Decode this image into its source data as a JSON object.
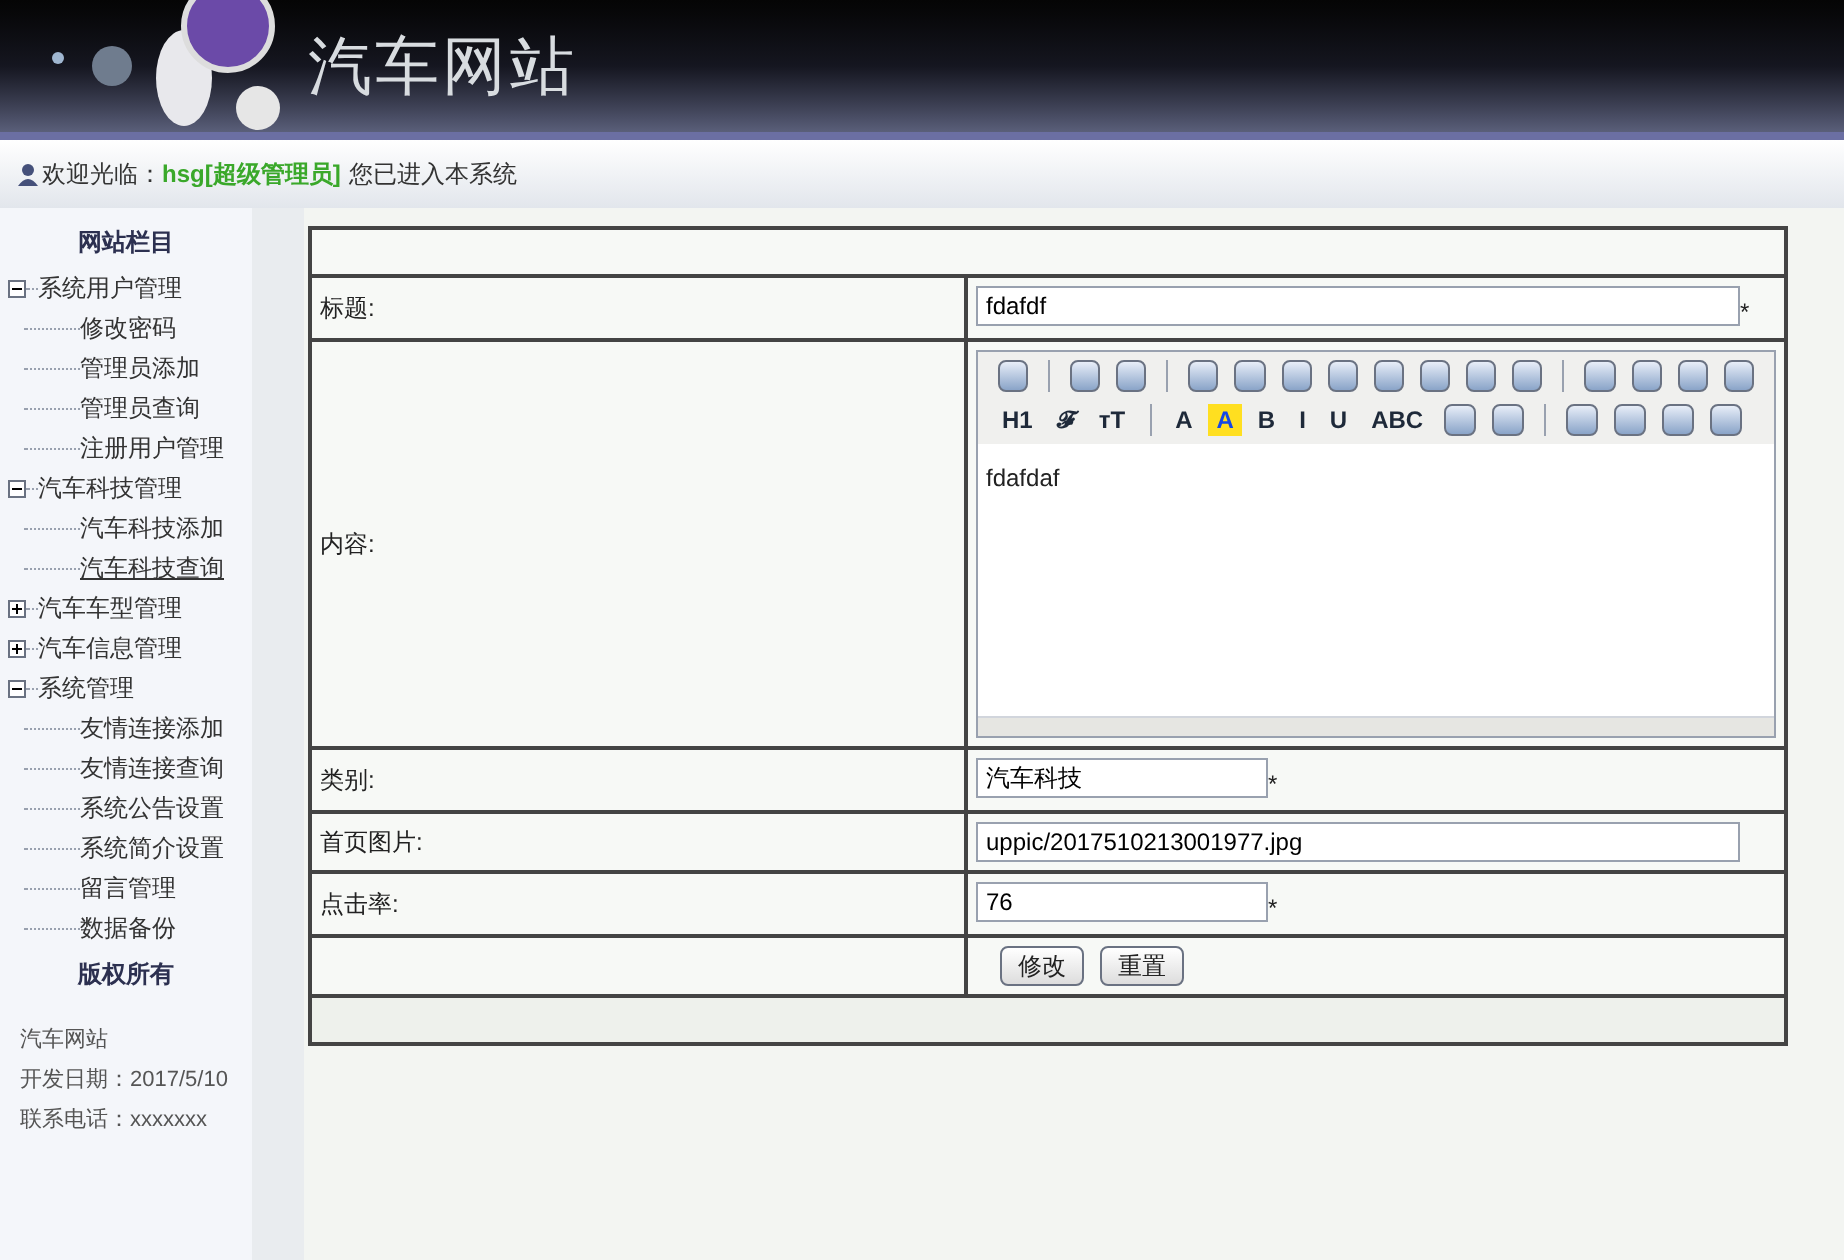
{
  "header": {
    "title": "汽车网站"
  },
  "welcome": {
    "greeting": "欢迎光临：",
    "user": "hsg[超级管理员]",
    "message": "您已进入本系统"
  },
  "sidebar": {
    "heading": "网站栏目",
    "tree": [
      {
        "label": "系统用户管理",
        "expanded": true,
        "children": [
          {
            "label": "修改密码",
            "selected": false
          },
          {
            "label": "管理员添加",
            "selected": false
          },
          {
            "label": "管理员查询",
            "selected": false
          },
          {
            "label": "注册用户管理",
            "selected": false
          }
        ]
      },
      {
        "label": "汽车科技管理",
        "expanded": true,
        "children": [
          {
            "label": "汽车科技添加",
            "selected": false
          },
          {
            "label": "汽车科技查询",
            "selected": true
          }
        ]
      },
      {
        "label": "汽车车型管理",
        "expanded": false
      },
      {
        "label": "汽车信息管理",
        "expanded": false
      },
      {
        "label": "系统管理",
        "expanded": true,
        "children": [
          {
            "label": "友情连接添加",
            "selected": false
          },
          {
            "label": "友情连接查询",
            "selected": false
          },
          {
            "label": "系统公告设置",
            "selected": false
          },
          {
            "label": "系统简介设置",
            "selected": false
          },
          {
            "label": "留言管理",
            "selected": false
          },
          {
            "label": "数据备份",
            "selected": false
          }
        ]
      }
    ],
    "copyright": "版权所有",
    "footer": [
      "汽车网站",
      "开发日期：2017/5/10",
      "联系电话：xxxxxxx"
    ]
  },
  "form": {
    "rows": [
      {
        "kind": "wide-input",
        "label": "标题:",
        "value": "fdafdf",
        "mark": "*"
      },
      {
        "kind": "editor",
        "label": "内容:",
        "value": "fdafdaf",
        "toolbar": [
          [
            {
              "kind": "icon"
            },
            {
              "kind": "sep"
            },
            {
              "kind": "icon"
            },
            {
              "kind": "icon"
            },
            {
              "kind": "sep"
            },
            {
              "kind": "icon"
            },
            {
              "kind": "icon"
            },
            {
              "kind": "icon"
            },
            {
              "kind": "icon"
            },
            {
              "kind": "icon"
            },
            {
              "kind": "icon"
            },
            {
              "kind": "icon"
            },
            {
              "kind": "icon"
            },
            {
              "kind": "sep"
            },
            {
              "kind": "icon"
            },
            {
              "kind": "icon"
            },
            {
              "kind": "icon"
            },
            {
              "kind": "icon"
            }
          ],
          [
            {
              "kind": "text",
              "label": "H1"
            },
            {
              "kind": "text",
              "label": "𝓕"
            },
            {
              "kind": "text",
              "label": "тT"
            },
            {
              "kind": "sep"
            },
            {
              "kind": "text",
              "label": "A"
            },
            {
              "kind": "highlight",
              "label": "A"
            },
            {
              "kind": "text",
              "label": "B"
            },
            {
              "kind": "text",
              "label": "I"
            },
            {
              "kind": "text",
              "label": "U"
            },
            {
              "kind": "text",
              "label": "ABC"
            },
            {
              "kind": "icon"
            },
            {
              "kind": "icon"
            },
            {
              "kind": "sep"
            },
            {
              "kind": "icon"
            },
            {
              "kind": "icon"
            },
            {
              "kind": "icon"
            },
            {
              "kind": "icon"
            }
          ]
        ]
      },
      {
        "kind": "short-input",
        "label": "类别:",
        "value": "汽车科技",
        "mark": "*"
      },
      {
        "kind": "wide-input",
        "label": "首页图片:",
        "value": "uppic/2017510213001977.jpg"
      },
      {
        "kind": "short-input",
        "label": "点击率:",
        "value": "76",
        "mark": "*"
      },
      {
        "kind": "buttons",
        "buttons": [
          "修改",
          "重置"
        ]
      }
    ]
  }
}
